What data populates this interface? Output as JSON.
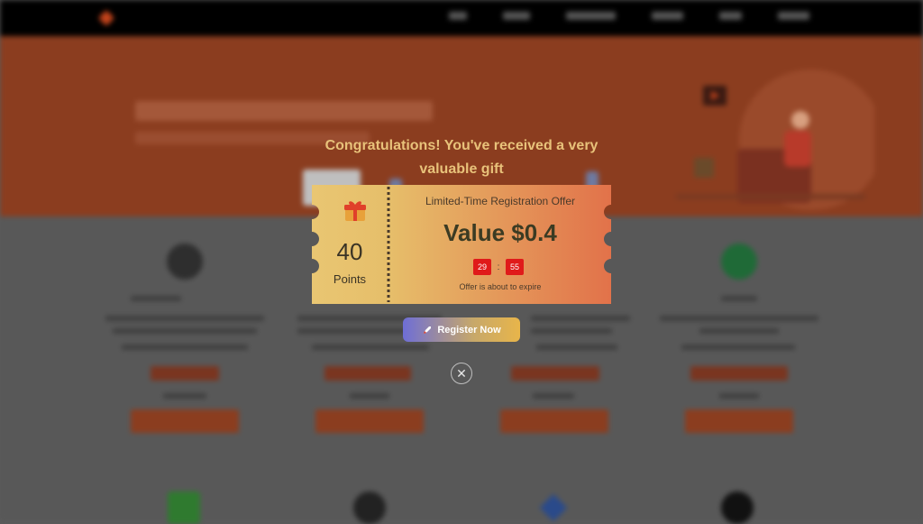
{
  "overlay": {
    "headline": "Congratulations! You've received a very valuable gift",
    "points_value": "40",
    "points_label": "Points",
    "offer_title": "Limited-Time Registration Offer",
    "value_text": "Value $0.4",
    "timer_minutes": "29",
    "timer_separator": ":",
    "timer_seconds": "55",
    "expire_note": "Offer is about to expire",
    "register_label": "Register Now",
    "close_glyph": "✕",
    "gift_icon": "gift-icon",
    "rocket_icon": "rocket-icon"
  },
  "colors": {
    "headline_gradient_start": "#f0c06e",
    "headline_gradient_end": "#b9d6a5",
    "coupon_left": "#e7c16f",
    "coupon_right": "#e2734a",
    "timer_red": "#e01a1a",
    "background_accent": "#c2431b"
  }
}
